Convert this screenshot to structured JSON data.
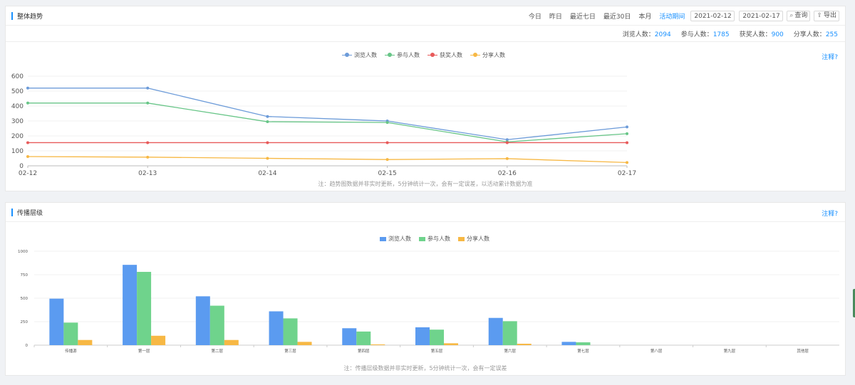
{
  "trend": {
    "title": "整体趋势",
    "filters": [
      "今日",
      "昨日",
      "最近七日",
      "最近30日",
      "本月",
      "活动期间"
    ],
    "active_filter": "活动期间",
    "date_start": "2021-02-12",
    "date_end": "2021-02-17",
    "query_label": "查询",
    "export_label": "导出",
    "stats": [
      {
        "label": "浏览人数：",
        "value": "2094"
      },
      {
        "label": "参与人数：",
        "value": "1785"
      },
      {
        "label": "获奖人数：",
        "value": "900"
      },
      {
        "label": "分享人数：",
        "value": "255"
      }
    ],
    "notes_link": "注释?",
    "footnote": "注：趋势图数据并非实时更新，5分钟统计一次，会有一定误差，以活动累计数据为准"
  },
  "spread": {
    "title": "传播层级",
    "notes_link": "注释?",
    "footnote": "注：传播层级数据并非实时更新，5分钟统计一次，会有一定误差"
  },
  "chart_data": [
    {
      "type": "line",
      "x": [
        "02-12",
        "02-13",
        "02-14",
        "02-15",
        "02-16",
        "02-17"
      ],
      "ylim": [
        0,
        600
      ],
      "yticks": [
        0,
        100,
        200,
        300,
        400,
        500,
        600
      ],
      "legend_position": "top-center",
      "series": [
        {
          "name": "浏览人数",
          "color": "#6c9bd9",
          "values": [
            520,
            520,
            330,
            300,
            175,
            260
          ]
        },
        {
          "name": "参与人数",
          "color": "#67c587",
          "values": [
            420,
            420,
            295,
            290,
            160,
            215
          ]
        },
        {
          "name": "获奖人数",
          "color": "#e85a5a",
          "values": [
            155,
            155,
            155,
            155,
            155,
            155
          ]
        },
        {
          "name": "分享人数",
          "color": "#f7b844",
          "values": [
            62,
            58,
            50,
            42,
            48,
            22
          ]
        }
      ]
    },
    {
      "type": "bar",
      "categories": [
        "传播源",
        "第一层",
        "第二层",
        "第三层",
        "第四层",
        "第五层",
        "第六层",
        "第七层",
        "第八层",
        "第九层",
        "其他层"
      ],
      "ylim": [
        0,
        1000
      ],
      "yticks": [
        0,
        250,
        500,
        750,
        1000
      ],
      "legend_position": "top-center",
      "series": [
        {
          "name": "浏览人数",
          "color": "#5b9bf0",
          "values": [
            495,
            855,
            520,
            360,
            180,
            190,
            290,
            35,
            0,
            0,
            0
          ]
        },
        {
          "name": "参与人数",
          "color": "#6fd38c",
          "values": [
            240,
            780,
            420,
            285,
            145,
            165,
            255,
            30,
            0,
            0,
            0
          ]
        },
        {
          "name": "分享人数",
          "color": "#f7b844",
          "values": [
            55,
            100,
            55,
            35,
            8,
            20,
            15,
            0,
            0,
            0,
            0
          ]
        }
      ]
    }
  ]
}
